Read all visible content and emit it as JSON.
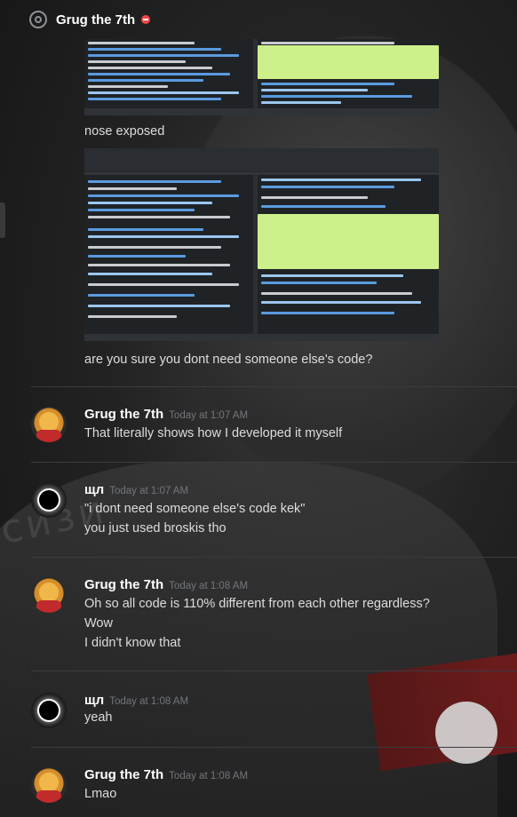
{
  "channel": {
    "title": "Grug the 7th"
  },
  "icons": {
    "mention": "at-icon",
    "status": "dnd-icon"
  },
  "colors": {
    "dnd": "#f04747",
    "name": "#ffffff",
    "timestamp": "#72767d",
    "text": "#dcddde"
  },
  "background": {
    "text": "сизи"
  },
  "attachments": {
    "caption1": "nose exposed",
    "caption2": "are you sure you dont need someone else's code?"
  },
  "messages": [
    {
      "author": "Grug the 7th",
      "time": "Today at 1:07 AM",
      "lines": [
        "That literally shows how I developed it myself"
      ]
    },
    {
      "author": "щл",
      "time": "Today at 1:07 AM",
      "lines": [
        "\"i dont need someone else's code kek\"",
        "you just used broskis tho"
      ]
    },
    {
      "author": "Grug the 7th",
      "time": "Today at 1:08 AM",
      "lines": [
        "Oh so all code is 110% different from each other regardless?",
        "Wow",
        "I didn't know that"
      ]
    },
    {
      "author": "щл",
      "time": "Today at 1:08 AM",
      "lines": [
        "yeah"
      ]
    },
    {
      "author": "Grug the 7th",
      "time": "Today at 1:08 AM",
      "lines": [
        "Lmao"
      ]
    }
  ]
}
